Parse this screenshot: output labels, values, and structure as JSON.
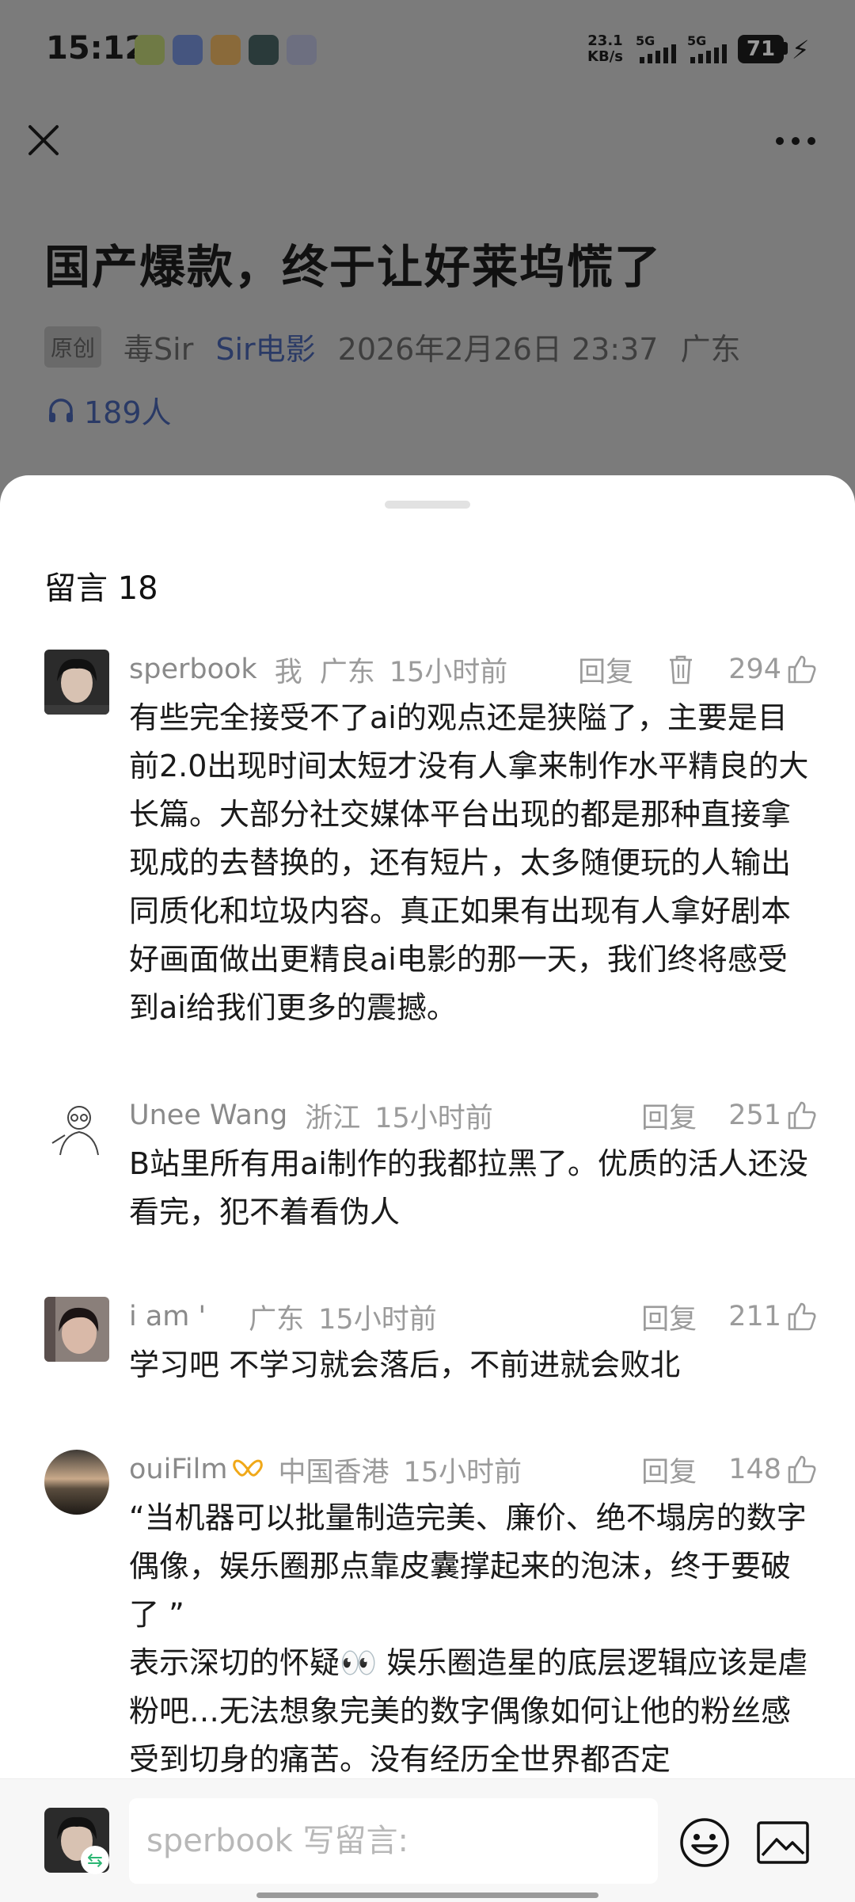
{
  "status_bar": {
    "time": "15:12",
    "net_speed_value": "23.1",
    "net_speed_unit": "KB/s",
    "signal1": "5G",
    "signal2": "5G",
    "battery": "71"
  },
  "article": {
    "title": "国产爆款，终于让好莱坞慌了",
    "tag": "原创",
    "author": "毒Sir",
    "account": "Sir电影",
    "datetime": "2026年2月26日 23:37",
    "region": "广东",
    "listeners": "189人"
  },
  "sheet": {
    "title": "留言 18"
  },
  "comments": [
    {
      "name": "sperbook",
      "me": "我",
      "location": "广东",
      "time": "15小时前",
      "reply": "回复",
      "likes": "294",
      "body": "有些完全接受不了ai的观点还是狭隘了，主要是目前2.0出现时间太短才没有人拿来制作水平精良的大长篇。大部分社交媒体平台出现的都是那种直接拿现成的去替换的，还有短片，太多随便玩的人输出同质化和垃圾内容。真正如果有出现有人拿好剧本好画面做出更精良ai电影的那一天，我们终将感受到ai给我们更多的震撼。"
    },
    {
      "name": "Unee Wang",
      "location": "浙江",
      "time": "15小时前",
      "reply": "回复",
      "likes": "251",
      "body": "B站里所有用ai制作的我都拉黑了。优质的活人还没看完，犯不着看伪人"
    },
    {
      "name": "i am '",
      "location": "广东",
      "time": "15小时前",
      "reply": "回复",
      "likes": "211",
      "body": "学习吧 不学习就会落后，不前进就会败北"
    },
    {
      "name": "ouiFilm",
      "location": "中国香港",
      "time": "15小时前",
      "reply": "回复",
      "likes": "148",
      "body": "“当机器可以批量制造完美、廉价、绝不塌房的数字偶像，娱乐圈那点靠皮囊撑起来的泡沫，终于要破了 ”\n表示深切的怀疑👀 娱乐圈造星的底层逻辑应该是虐粉吧…无法想象完美的数字偶像如何让他的粉丝感受到切身的痛苦。没有经历全世界都否定"
    }
  ],
  "input_bar": {
    "placeholder": "sperbook 写留言:"
  },
  "colors": {
    "overlay": "#7b7b7b",
    "account_blue": "#2a3a66",
    "meta_gray": "#9b9b9b"
  }
}
